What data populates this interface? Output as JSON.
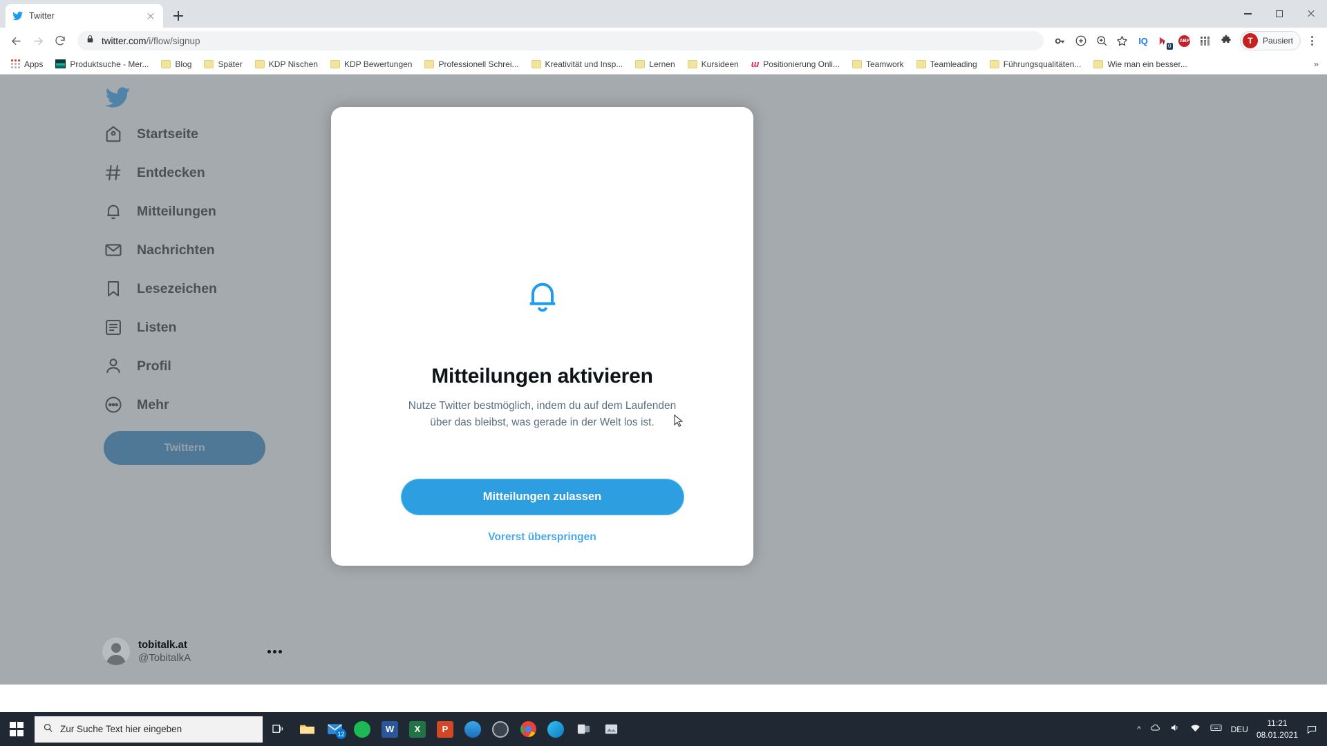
{
  "browser": {
    "tab": {
      "title": "Twitter",
      "favicon": "twitter-bird-icon",
      "close_icon": "close-icon"
    },
    "new_tab_label": "+",
    "window_controls": {
      "minimize": "minimize-icon",
      "maximize": "maximize-icon",
      "close": "close-icon"
    },
    "nav": {
      "back": "back-arrow-icon",
      "forward": "forward-arrow-icon",
      "reload": "reload-icon"
    },
    "omnibox": {
      "lock_icon": "lock-icon",
      "domain": "twitter.com",
      "path": "/i/flow/signup",
      "full_url": "twitter.com/i/flow/signup"
    },
    "toolbar_icons": [
      {
        "name": "password-key-icon",
        "label": ""
      },
      {
        "name": "add-circle-icon",
        "label": ""
      },
      {
        "name": "zoom-search-icon",
        "label": ""
      },
      {
        "name": "bookmark-star-icon",
        "label": ""
      },
      {
        "name": "iq-extension-icon",
        "label": "IQ"
      },
      {
        "name": "buffer-extension-icon",
        "label": "0"
      },
      {
        "name": "adblock-plus-icon",
        "label": "ABP"
      },
      {
        "name": "apps-grid-icon",
        "label": ""
      },
      {
        "name": "extensions-puzzle-icon",
        "label": ""
      }
    ],
    "profile": {
      "avatar_letter": "T",
      "status_label": "Pausiert"
    },
    "menu_icon": "three-dot-menu-icon",
    "bookmarks": [
      {
        "label": "Apps",
        "icon": "apps-grid-icon"
      },
      {
        "label": "Produktsuche - Mer...",
        "icon": "site-thumbnail-icon"
      },
      {
        "label": "Blog",
        "icon": "folder-icon"
      },
      {
        "label": "Später",
        "icon": "folder-icon"
      },
      {
        "label": "KDP Nischen",
        "icon": "folder-icon"
      },
      {
        "label": "KDP Bewertungen",
        "icon": "folder-icon"
      },
      {
        "label": "Professionell Schrei...",
        "icon": "folder-icon"
      },
      {
        "label": "Kreativität und Insp...",
        "icon": "folder-icon"
      },
      {
        "label": "Lernen",
        "icon": "folder-icon"
      },
      {
        "label": "Kursideen",
        "icon": "folder-icon"
      },
      {
        "label": "Positionierung Onli...",
        "icon": "mailchimp-icon"
      },
      {
        "label": "Teamwork",
        "icon": "folder-icon"
      },
      {
        "label": "Teamleading",
        "icon": "folder-icon"
      },
      {
        "label": "Führungsqualitäten...",
        "icon": "folder-icon"
      },
      {
        "label": "Wie man ein besser...",
        "icon": "folder-icon"
      }
    ],
    "bookmarks_overflow": "»"
  },
  "twitter": {
    "logo": "twitter-bird-icon",
    "nav": [
      {
        "label": "Startseite",
        "icon": "home-icon"
      },
      {
        "label": "Entdecken",
        "icon": "hashtag-icon"
      },
      {
        "label": "Mitteilungen",
        "icon": "bell-icon"
      },
      {
        "label": "Nachrichten",
        "icon": "envelope-icon"
      },
      {
        "label": "Lesezeichen",
        "icon": "bookmark-icon"
      },
      {
        "label": "Listen",
        "icon": "list-icon"
      },
      {
        "label": "Profil",
        "icon": "person-icon"
      },
      {
        "label": "Mehr",
        "icon": "more-circle-icon"
      }
    ],
    "tweet_button": "Twittern",
    "account": {
      "name": "tobitalk.at",
      "handle": "@TobitalkA",
      "avatar": "default-avatar-icon",
      "more_icon": "three-dot-icon"
    }
  },
  "modal": {
    "icon": "bell-icon",
    "title": "Mitteilungen aktivieren",
    "subtitle": "Nutze Twitter bestmöglich, indem du auf dem Laufenden über das bleibst, was gerade in der Welt los ist.",
    "primary_button": "Mitteilungen zulassen",
    "skip_link": "Vorerst überspringen"
  },
  "taskbar": {
    "start_icon": "windows-start-icon",
    "search_placeholder": "Zur Suche Text hier eingeben",
    "search_icon": "search-icon",
    "task_view_icon": "task-view-icon",
    "apps": [
      {
        "name": "file-explorer-icon",
        "label": ""
      },
      {
        "name": "mail-icon",
        "label": "12"
      },
      {
        "name": "spotify-icon",
        "label": ""
      },
      {
        "name": "word-icon",
        "label": "W"
      },
      {
        "name": "excel-icon",
        "label": "X"
      },
      {
        "name": "powerpoint-icon",
        "label": "P"
      },
      {
        "name": "thunderbird-icon",
        "label": ""
      },
      {
        "name": "obs-icon",
        "label": ""
      },
      {
        "name": "chrome-icon",
        "label": ""
      },
      {
        "name": "edge-icon",
        "label": ""
      },
      {
        "name": "teams-icon",
        "label": ""
      },
      {
        "name": "photos-icon",
        "label": ""
      }
    ],
    "tray": {
      "chevron": "^",
      "cloud_icon": "onedrive-icon",
      "volume_icon": "speaker-icon",
      "network_icon": "network-icon",
      "keyboard_icon": "keyboard-icon",
      "language": "DEU",
      "time": "11:21",
      "date": "08.01.2021",
      "notification_icon": "notification-icon"
    }
  },
  "colors": {
    "twitter_blue": "#1d9bf0",
    "button_blue": "#2d9ee0",
    "tweet_button": "#1b7bbf",
    "chrome_tabstrip": "#dee1e6",
    "taskbar": "#1f2833",
    "dim_overlay": "rgba(110,118,125,0.62)"
  }
}
